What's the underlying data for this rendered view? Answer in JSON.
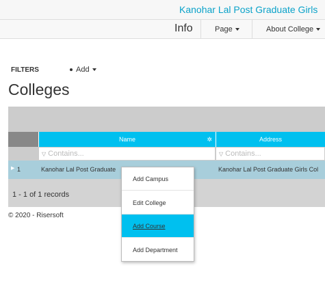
{
  "site_title": "Kanohar Lal Post Graduate Girls",
  "navbar": {
    "info": "Info",
    "page_menu": "Page",
    "about_menu": "About College"
  },
  "toolbar": {
    "filters_label": "FILTERS",
    "add_label": "Add"
  },
  "page_title": "Colleges",
  "grid": {
    "columns": [
      "Name",
      "Address"
    ],
    "filter_placeholder": "Contains...",
    "rows": [
      {
        "number": "1",
        "name": "Kanohar Lal Post Graduate",
        "address": "Kanohar Lal Post Graduate Girls Col"
      }
    ],
    "pager_text": "1 - 1 of 1 records"
  },
  "context_menu": {
    "items": [
      "Add Campus",
      "Edit College",
      "Add Course",
      "Add Department"
    ],
    "active_index": 2
  },
  "footer": "© 2020 - Risersoft",
  "colors": {
    "accent": "#00c0ef",
    "title_link": "#0aa2c9",
    "selected_row": "#a8cedb"
  }
}
